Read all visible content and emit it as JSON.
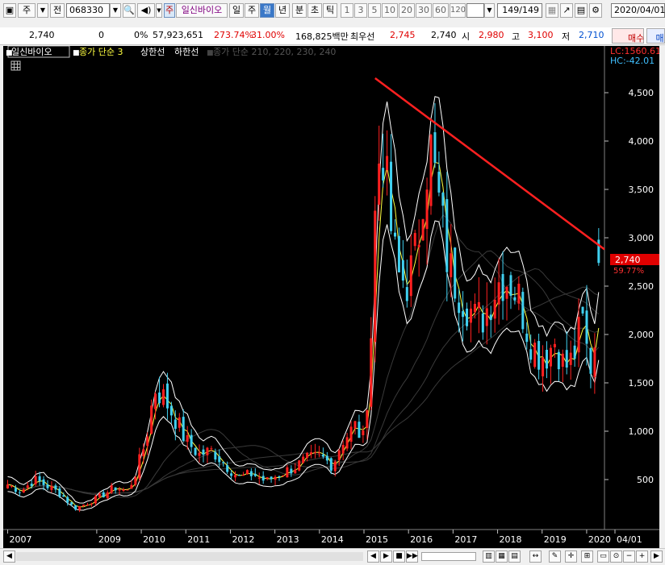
{
  "toolbar": {
    "type_label": "주",
    "type2_label": "전",
    "code": "068330",
    "stock_tag": "주",
    "stock_name": "일신바이오",
    "periods": [
      "일",
      "주",
      "월",
      "년",
      "분",
      "초",
      "틱"
    ],
    "selected_period": "월",
    "numbers": [
      "1",
      "3",
      "5",
      "10",
      "20",
      "30",
      "60",
      "120"
    ],
    "count": "149/149",
    "date": "2020/04/01"
  },
  "info": {
    "price": "2,740",
    "change": "0",
    "change_pct": "0%",
    "volume": "57,923,651",
    "vol_ratio": "273.74%",
    "turnover": "31.00%",
    "amount": "168,825백만",
    "best_label": "최우선",
    "ask": "2,745",
    "bid": "2,740",
    "open_label": "시",
    "open": "2,980",
    "high_label": "고",
    "high": "3,100",
    "low_label": "저",
    "low": "2,710",
    "buy_label": "매수",
    "sell_label": "매도"
  },
  "legend": {
    "name": "일신바이오",
    "item1": "종가 단순 3",
    "item2": "상한선",
    "item3": "하한선",
    "item4": "종가 단순 210, 220, 230, 240"
  },
  "readouts": {
    "lc": "LC:1560.61",
    "hc": "HC:-42.01",
    "current": "2,740",
    "pct": "59.77%"
  },
  "colors": {
    "up": "#ff2020",
    "down": "#40d0f0",
    "trend": "#ff2020",
    "ma": "#ffff40",
    "band": "#ffffff"
  },
  "chart_data": {
    "type": "candlestick",
    "y_ticks": [
      "4,500",
      "4,000",
      "3,500",
      "3,000",
      "2,500",
      "2,000",
      "1,500",
      "1,000",
      "500"
    ],
    "y_tick_values": [
      4500,
      4000,
      3500,
      3000,
      2500,
      2000,
      1500,
      1000,
      500
    ],
    "x_labels": [
      "2007",
      "2009",
      "2010",
      "2011",
      "2012",
      "2013",
      "2014",
      "2015",
      "2016",
      "2017",
      "2018",
      "2019",
      "2020",
      "04/01"
    ],
    "x_label_years": [
      2007,
      2009,
      2010,
      2011,
      2012,
      2013,
      2014,
      2015,
      2016,
      2017,
      2018,
      2019,
      2020,
      2020.27
    ],
    "ylim": [
      0,
      4900
    ],
    "xlim": [
      2006.9,
      2020.4
    ],
    "trendline": [
      [
        2015.25,
        4650
      ],
      [
        2020.4,
        2880
      ]
    ],
    "anchors": [
      [
        2007.0,
        450
      ],
      [
        2007.3,
        380
      ],
      [
        2007.6,
        500
      ],
      [
        2007.9,
        430
      ],
      [
        2008.2,
        350
      ],
      [
        2008.5,
        200
      ],
      [
        2008.8,
        260
      ],
      [
        2009.1,
        330
      ],
      [
        2009.4,
        420
      ],
      [
        2009.7,
        380
      ],
      [
        2009.9,
        600
      ],
      [
        2010.1,
        900
      ],
      [
        2010.3,
        1450
      ],
      [
        2010.5,
        1350
      ],
      [
        2010.8,
        1100
      ],
      [
        2011.0,
        900
      ],
      [
        2011.3,
        760
      ],
      [
        2011.6,
        800
      ],
      [
        2011.9,
        650
      ],
      [
        2012.2,
        520
      ],
      [
        2012.5,
        560
      ],
      [
        2012.8,
        480
      ],
      [
        2013.1,
        560
      ],
      [
        2013.4,
        620
      ],
      [
        2013.7,
        700
      ],
      [
        2014.0,
        740
      ],
      [
        2014.3,
        650
      ],
      [
        2014.5,
        900
      ],
      [
        2014.8,
        1050
      ],
      [
        2015.0,
        900
      ],
      [
        2015.15,
        1900
      ],
      [
        2015.27,
        3500
      ],
      [
        2015.4,
        4100
      ],
      [
        2015.55,
        3300
      ],
      [
        2015.75,
        2600
      ],
      [
        2016.0,
        2550
      ],
      [
        2016.2,
        2900
      ],
      [
        2016.35,
        3700
      ],
      [
        2016.5,
        3900
      ],
      [
        2016.7,
        3300
      ],
      [
        2016.9,
        2700
      ],
      [
        2017.1,
        2500
      ],
      [
        2017.35,
        2300
      ],
      [
        2017.5,
        2150
      ],
      [
        2017.7,
        2200
      ],
      [
        2017.9,
        2450
      ],
      [
        2018.1,
        2600
      ],
      [
        2018.3,
        2550
      ],
      [
        2018.5,
        2350
      ],
      [
        2018.7,
        2000
      ],
      [
        2018.9,
        1800
      ],
      [
        2019.1,
        1800
      ],
      [
        2019.3,
        1950
      ],
      [
        2019.5,
        1650
      ],
      [
        2019.7,
        1750
      ],
      [
        2019.9,
        2150
      ],
      [
        2020.05,
        1700
      ],
      [
        2020.15,
        1650
      ],
      [
        2020.27,
        2740
      ]
    ]
  }
}
